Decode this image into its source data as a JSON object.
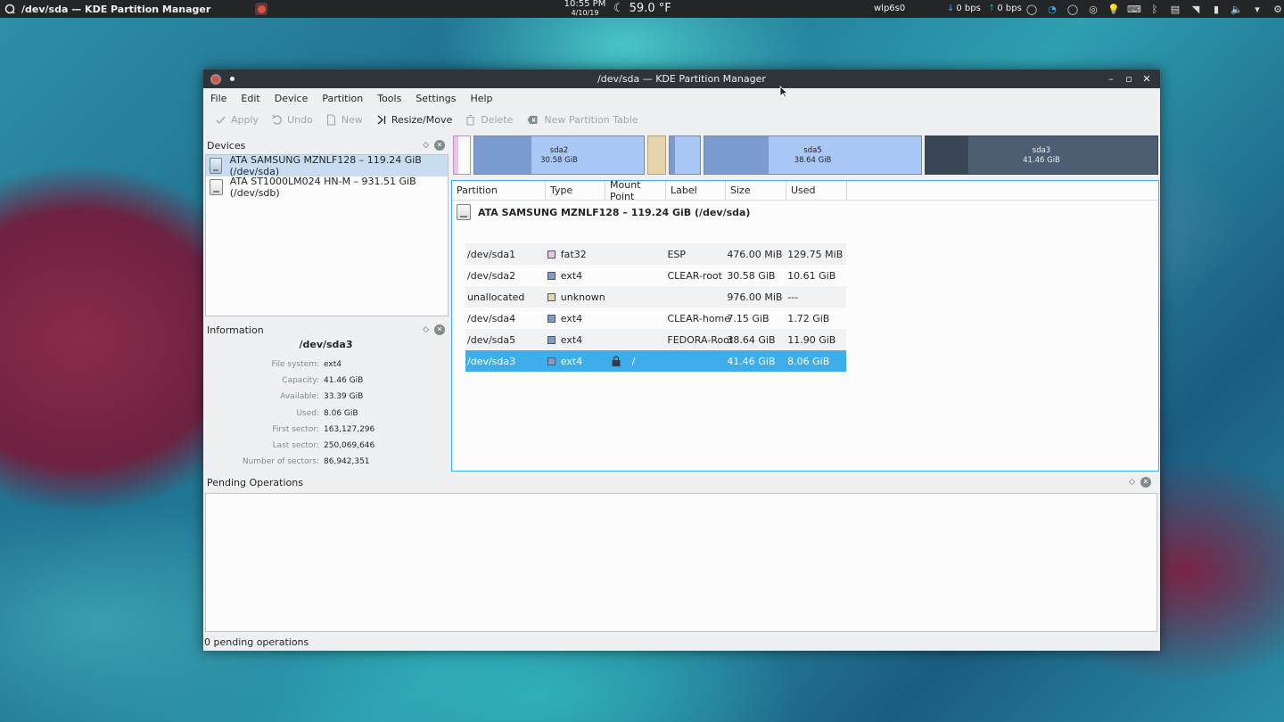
{
  "panel": {
    "window_title": "/dev/sda — KDE Partition Manager",
    "time": "10:55 PM",
    "date": "4/10/19",
    "temperature": "59.0 °F",
    "network_interface": "wlp6s0",
    "download_rate": "0 bps",
    "upload_rate": "0 bps"
  },
  "window": {
    "title": "/dev/sda — KDE Partition Manager"
  },
  "menu": [
    "File",
    "Edit",
    "Device",
    "Partition",
    "Tools",
    "Settings",
    "Help"
  ],
  "toolbar": {
    "apply": "Apply",
    "undo": "Undo",
    "new": "New",
    "resize_move": "Resize/Move",
    "delete": "Delete",
    "new_partition_table": "New Partition Table"
  },
  "devices": {
    "title": "Devices",
    "items": [
      "ATA SAMSUNG MZNLF128 – 119.24 GiB (/dev/sda)",
      "ATA ST1000LM024 HN-M – 931.51 GiB (/dev/sdb)"
    ]
  },
  "information": {
    "title": "Information",
    "device": "/dev/sda3",
    "rows": [
      {
        "key": "File system:",
        "value": "ext4"
      },
      {
        "key": "Capacity:",
        "value": "41.46 GiB"
      },
      {
        "key": "Available:",
        "value": "33.39 GiB"
      },
      {
        "key": "Used:",
        "value": "8.06 GiB"
      },
      {
        "key": "First sector:",
        "value": "163,127,296"
      },
      {
        "key": "Last sector:",
        "value": "250,069,646"
      },
      {
        "key": "Number of sectors:",
        "value": "86,942,351"
      }
    ]
  },
  "partition_bar": [
    {
      "name": "",
      "size": ""
    },
    {
      "name": "sda2",
      "size": "30.58 GiB"
    },
    {
      "name": "",
      "size": ""
    },
    {
      "name": "",
      "size": ""
    },
    {
      "name": "sda5",
      "size": "38.64 GiB"
    },
    {
      "name": "sda3",
      "size": "41.46 GiB"
    }
  ],
  "table": {
    "columns": [
      "Partition",
      "Type",
      "Mount Point",
      "Label",
      "Size",
      "Used"
    ],
    "disk": "ATA SAMSUNG MZNLF128 – 119.24 GiB (/dev/sda)",
    "rows": [
      {
        "partition": "/dev/sda1",
        "type": "fat32",
        "mount": "",
        "label": "ESP",
        "size": "476.00 MiB",
        "used": "129.75 MiB",
        "color": "#e9c3e9"
      },
      {
        "partition": "/dev/sda2",
        "type": "ext4",
        "mount": "",
        "label": "CLEAR-root",
        "size": "30.58 GiB",
        "used": "10.61 GiB",
        "color": "#7c9bd0"
      },
      {
        "partition": "unallocated",
        "type": "unknown",
        "mount": "",
        "label": "",
        "size": "976.00 MiB",
        "used": "---",
        "color": "#e5d4ae"
      },
      {
        "partition": "/dev/sda4",
        "type": "ext4",
        "mount": "",
        "label": "CLEAR-home",
        "size": "7.15 GiB",
        "used": "1.72 GiB",
        "color": "#7c9bd0"
      },
      {
        "partition": "/dev/sda5",
        "type": "ext4",
        "mount": "",
        "label": "FEDORA-Root",
        "size": "38.64 GiB",
        "used": "11.90 GiB",
        "color": "#7c9bd0"
      },
      {
        "partition": "/dev/sda3",
        "type": "ext4",
        "mount": "/",
        "label": "",
        "size": "41.46 GiB",
        "used": "8.06 GiB",
        "color": "#7c9bd0"
      }
    ]
  },
  "pending": {
    "title": "Pending Operations",
    "status": "0 pending operations"
  }
}
